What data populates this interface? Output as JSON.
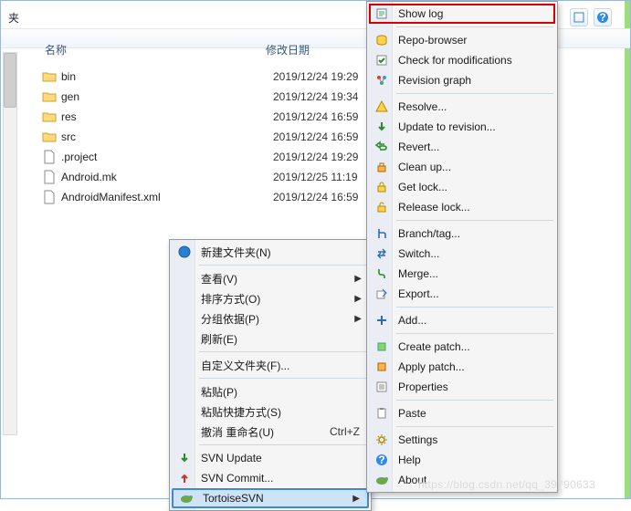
{
  "header": {
    "title_suffix": "夹"
  },
  "columns": {
    "name": "名称",
    "date": "修改日期"
  },
  "files": [
    {
      "type": "folder",
      "name": "bin",
      "date": "2019/12/24 19:29"
    },
    {
      "type": "folder",
      "name": "gen",
      "date": "2019/12/24 19:34"
    },
    {
      "type": "folder",
      "name": "res",
      "date": "2019/12/24 16:59"
    },
    {
      "type": "folder",
      "name": "src",
      "date": "2019/12/24 16:59"
    },
    {
      "type": "file",
      "name": ".project",
      "date": "2019/12/24 19:29"
    },
    {
      "type": "file",
      "name": "Android.mk",
      "date": "2019/12/25 11:19"
    },
    {
      "type": "file",
      "name": "AndroidManifest.xml",
      "date": "2019/12/24 16:59"
    }
  ],
  "ctx1": {
    "new_folder": "新建文件夹(N)",
    "view": "查看(V)",
    "sort": "排序方式(O)",
    "group": "分组依据(P)",
    "refresh": "刷新(E)",
    "custom_folder": "自定义文件夹(F)...",
    "paste": "粘贴(P)",
    "paste_shortcut": "粘贴快捷方式(S)",
    "undo_rename": "撤消 重命名(U)",
    "undo_hotkey": "Ctrl+Z",
    "svn_update": "SVN Update",
    "svn_commit": "SVN Commit...",
    "tortoise": "TortoiseSVN"
  },
  "ctx2": {
    "show_log": "Show log",
    "repo_browser": "Repo-browser",
    "check_mods": "Check for modifications",
    "rev_graph": "Revision graph",
    "resolve": "Resolve...",
    "update_rev": "Update to revision...",
    "revert": "Revert...",
    "cleanup": "Clean up...",
    "get_lock": "Get lock...",
    "release_lock": "Release lock...",
    "branch_tag": "Branch/tag...",
    "switch": "Switch...",
    "merge": "Merge...",
    "export": "Export...",
    "add": "Add...",
    "create_patch": "Create patch...",
    "apply_patch": "Apply patch...",
    "properties": "Properties",
    "paste": "Paste",
    "settings": "Settings",
    "help": "Help",
    "about": "About"
  },
  "watermark": "https://blog.csdn.net/qq_39790633"
}
